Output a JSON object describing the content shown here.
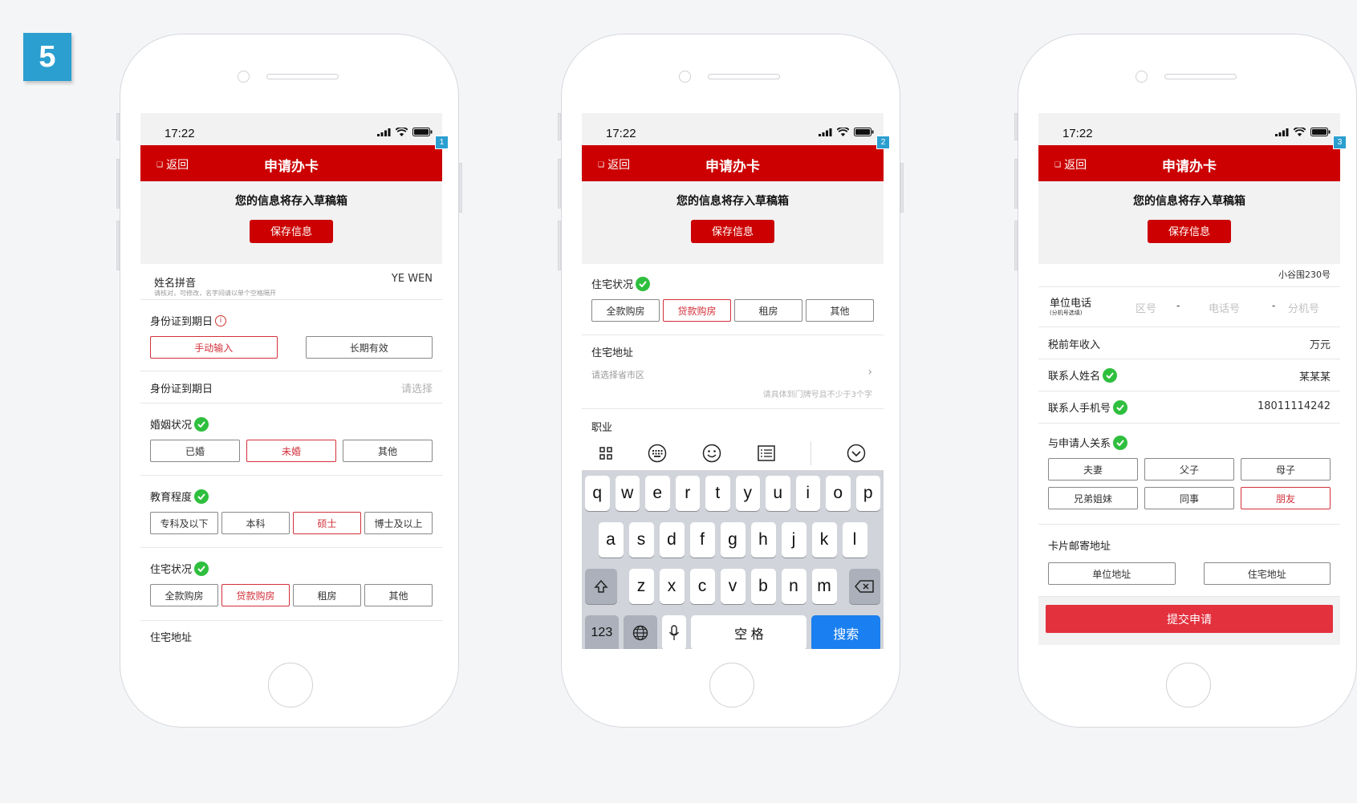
{
  "step_number": "5",
  "status": {
    "time": "17:22"
  },
  "nav": {
    "back": "返回",
    "title": "申请办卡"
  },
  "draft": {
    "message": "您的信息将存入草稿箱",
    "save_button": "保存信息"
  },
  "screens": [
    {
      "tag": "1",
      "name_pinyin": {
        "label": "姓名拼音",
        "hint": "请核对，可修改，名字间请以单个空格隔开",
        "value": "YE WEN"
      },
      "id_expiry_type": {
        "label": "身份证到期日",
        "options": [
          "手动输入",
          "长期有效"
        ],
        "selected": 0
      },
      "id_expiry_date": {
        "label": "身份证到期日",
        "placeholder": "请选择"
      },
      "marital": {
        "label": "婚姻状况",
        "options": [
          "已婚",
          "未婚",
          "其他"
        ],
        "selected": 1
      },
      "education": {
        "label": "教育程度",
        "options": [
          "专科及以下",
          "本科",
          "硕士",
          "博士及以上"
        ],
        "selected": 2
      },
      "housing": {
        "label": "住宅状况",
        "options": [
          "全款购房",
          "贷款购房",
          "租房",
          "其他"
        ],
        "selected": 1
      },
      "address_label": "住宅地址"
    },
    {
      "tag": "2",
      "housing": {
        "label": "住宅状况",
        "options": [
          "全款购房",
          "贷款购房",
          "租房",
          "其他"
        ],
        "selected": 1
      },
      "address": {
        "label": "住宅地址",
        "region_placeholder": "请选择省市区",
        "detail_placeholder": "请具体到门牌号且不少于3个字"
      },
      "occupation_label": "职业",
      "keyboard": {
        "row1": [
          "q",
          "w",
          "e",
          "r",
          "t",
          "y",
          "u",
          "i",
          "o",
          "p"
        ],
        "row2": [
          "a",
          "s",
          "d",
          "f",
          "g",
          "h",
          "j",
          "k",
          "l"
        ],
        "row3": [
          "z",
          "x",
          "c",
          "v",
          "b",
          "n",
          "m"
        ],
        "num_key": "123",
        "space_key": "空 格",
        "search_key": "搜索"
      }
    },
    {
      "tag": "3",
      "address_tail": "小谷围230号",
      "work_phone": {
        "label": "单位电话",
        "sub": "(分机号选填)",
        "area_placeholder": "区号",
        "phone_placeholder": "电话号",
        "ext_placeholder": "分机号",
        "sep": "-"
      },
      "income": {
        "label": "税前年收入",
        "unit": "万元"
      },
      "contact_name": {
        "label": "联系人姓名",
        "value": "某某某"
      },
      "contact_phone": {
        "label": "联系人手机号",
        "value": "18011114242"
      },
      "relation": {
        "label": "与申请人关系",
        "options": [
          "夫妻",
          "父子",
          "母子",
          "兄弟姐妹",
          "同事",
          "朋友"
        ],
        "selected": 5
      },
      "mailing": {
        "label": "卡片邮寄地址",
        "options": [
          "单位地址",
          "住宅地址"
        ]
      },
      "submit": "提交申请"
    }
  ],
  "colors": {
    "brand_red": "#cc0000",
    "tag_blue": "#2b9fd0",
    "check_green": "#2fbf3e",
    "keyboard_blue": "#1a7ff0",
    "submit_red": "#e3313e"
  }
}
